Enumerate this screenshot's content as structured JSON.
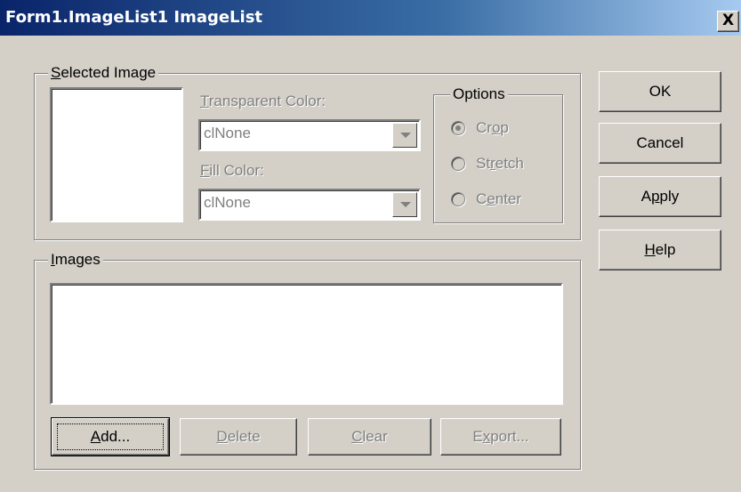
{
  "window": {
    "title": "Form1.ImageList1 ImageList",
    "close_glyph": "X"
  },
  "selected_image": {
    "legend_prefix": "",
    "legend_u": "S",
    "legend_rest": "elected Image",
    "transparent_color": {
      "label_u": "T",
      "label_rest": "ransparent Color:",
      "value": "clNone"
    },
    "fill_color": {
      "label_u": "F",
      "label_rest": "ill Color:",
      "value": "clNone"
    },
    "options": {
      "legend": "Options",
      "crop": {
        "pre": "Cr",
        "u": "o",
        "post": "p",
        "selected": true
      },
      "stretch": {
        "pre": "St",
        "u": "r",
        "post": "etch",
        "selected": false
      },
      "center": {
        "pre": "C",
        "u": "e",
        "post": "nter",
        "selected": false
      }
    }
  },
  "images": {
    "legend_u": "I",
    "legend_rest": "mages",
    "buttons": {
      "add": {
        "u": "A",
        "rest": "dd..."
      },
      "delete": {
        "u": "D",
        "rest": "elete"
      },
      "clear": {
        "u": "C",
        "rest": "lear"
      },
      "export": {
        "pre": "E",
        "u": "x",
        "rest": "port..."
      }
    }
  },
  "side_buttons": {
    "ok": "OK",
    "cancel": "Cancel",
    "apply": {
      "pre": "A",
      "u": "p",
      "rest": "ply"
    },
    "help": {
      "u": "H",
      "rest": "elp"
    }
  }
}
